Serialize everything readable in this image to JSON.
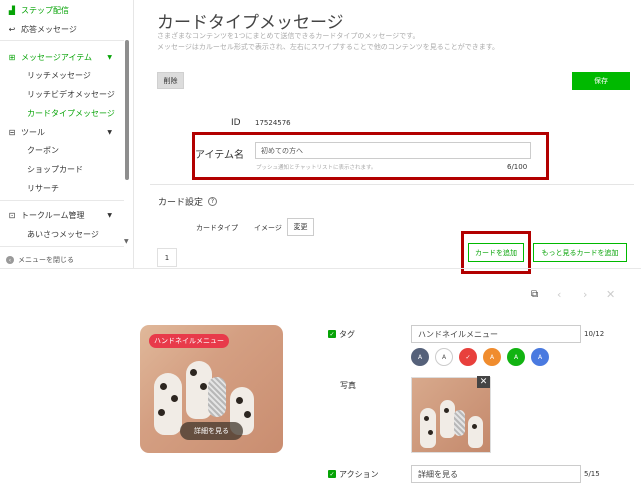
{
  "sidebar": {
    "items": [
      {
        "label": "ステップ配信",
        "icon": "chart-icon"
      },
      {
        "label": "応答メッセージ",
        "icon": "reply-icon"
      },
      {
        "label": "メッセージアイテム",
        "icon": "message-item-icon"
      },
      {
        "label": "リッチメッセージ"
      },
      {
        "label": "リッチビデオメッセージ"
      },
      {
        "label": "カードタイプメッセージ"
      },
      {
        "label": "ツール",
        "icon": "tools-icon"
      },
      {
        "label": "クーポン"
      },
      {
        "label": "ショップカード"
      },
      {
        "label": "リサーチ"
      },
      {
        "label": "トークルーム管理",
        "icon": "talkroom-icon"
      },
      {
        "label": "あいさつメッセージ"
      }
    ],
    "collapse_label": "メニューを閉じる"
  },
  "header": {
    "title": "カードタイプメッセージ",
    "desc_line1": "さまざまなコンテンツを1つにまとめて送信できるカードタイプのメッセージです。",
    "desc_line2": "メッセージはカルーセル形式で表示され、左右にスワイプすることで他のコンテンツを見ることができます。"
  },
  "toolbar": {
    "delete_label": "削除",
    "save_label": "保存"
  },
  "id": {
    "label": "ID",
    "value": "17524576"
  },
  "item_name": {
    "label": "アイテム名",
    "value": "初めての方へ",
    "help": "プッシュ通知とチャットリストに表示されます。",
    "count": "6/100"
  },
  "card_settings": {
    "title": "カード設定",
    "help_icon": "?",
    "type_label": "カードタイプ",
    "type_value": "イメージ",
    "change_label": "変更",
    "tab": "1",
    "add_card_label": "カードを追加",
    "add_more_label": "もっと見るカードを追加"
  },
  "card": {
    "tag_label": "タグ",
    "tag_value": "ハンドネイルメニュー",
    "tag_count": "10/12",
    "swatch_letter": "A",
    "swatches": [
      "#55617a",
      "#ffffff",
      "#e8403c",
      "#f08c2e",
      "#12b312",
      "#4a7ae0"
    ],
    "photo_label": "写真",
    "action_label": "アクション",
    "action_value": "詳細を見る",
    "action_count": "5/15"
  },
  "colors": {
    "accent": "#00b900",
    "highlight": "#b20000",
    "tag_bg": "#e83a4a"
  }
}
